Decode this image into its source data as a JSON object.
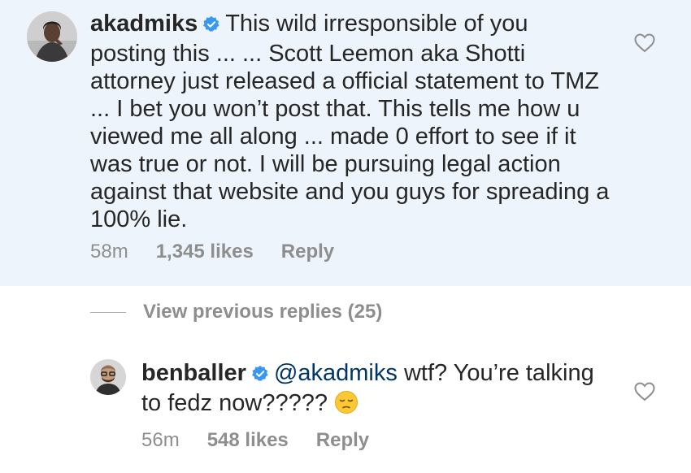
{
  "comments": [
    {
      "username": "akadmiks",
      "text": "This wild irresponsible of you posting this ... ... Scott Leemon aka Shotti attorney just released a official statement to TMZ ... I bet you won’t post that. This tells me how u viewed me all along ... made 0 effort to see if it was true or not. I will be pursuing legal action against that website and you guys for spreading a 100% lie.",
      "time": "58m",
      "likes": "1,345 likes",
      "reply_label": "Reply"
    },
    {
      "username": "benballer",
      "mention": "@akadmiks",
      "text": "wtf? You’re talking to fedz now?????",
      "time": "56m",
      "likes": "548 likes",
      "reply_label": "Reply"
    }
  ],
  "view_previous_replies": "View previous replies (25)",
  "icons": {
    "verified": "verified-badge-icon",
    "like": "heart-icon",
    "emoji": "pensive-face-emoji"
  },
  "colors": {
    "highlight_background": "#eef4fb",
    "verified_blue": "#3897f0",
    "meta_gray": "#8e8e8e",
    "mention_blue": "#003569"
  }
}
